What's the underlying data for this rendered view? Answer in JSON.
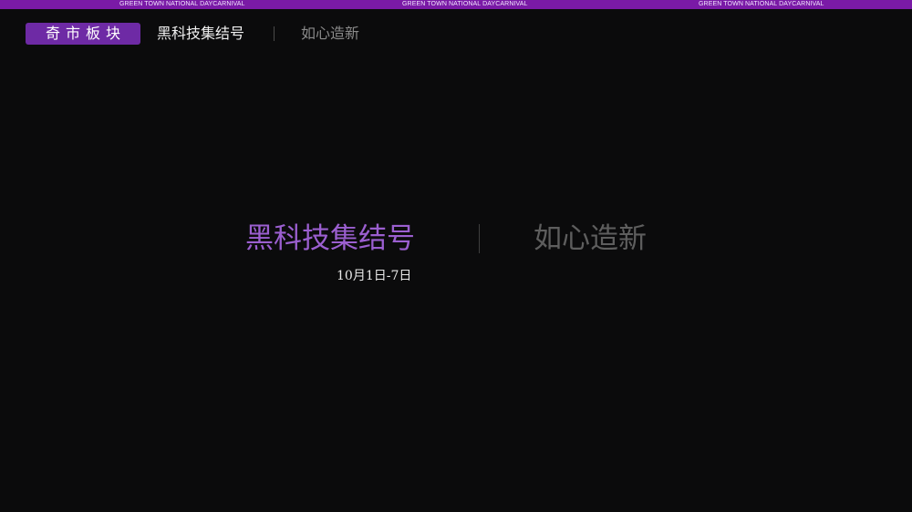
{
  "banner": {
    "texts": [
      "GREEN TOWN  NATIONAL DAYCARNIVAL",
      "GREEN TOWN  NATIONAL DAYCARNIVAL",
      "GREEN TOWN  NATIONAL DAYCARNIVAL"
    ],
    "color": "#7a1aa6"
  },
  "header": {
    "badge_label": "奇市板块",
    "title": "黑科技集结号",
    "subtitle": "如心造新"
  },
  "hero": {
    "title": "黑科技集结号",
    "subtitle": "如心造新",
    "date": "10月1日-7日",
    "accent_color": "#9b5fd0"
  }
}
